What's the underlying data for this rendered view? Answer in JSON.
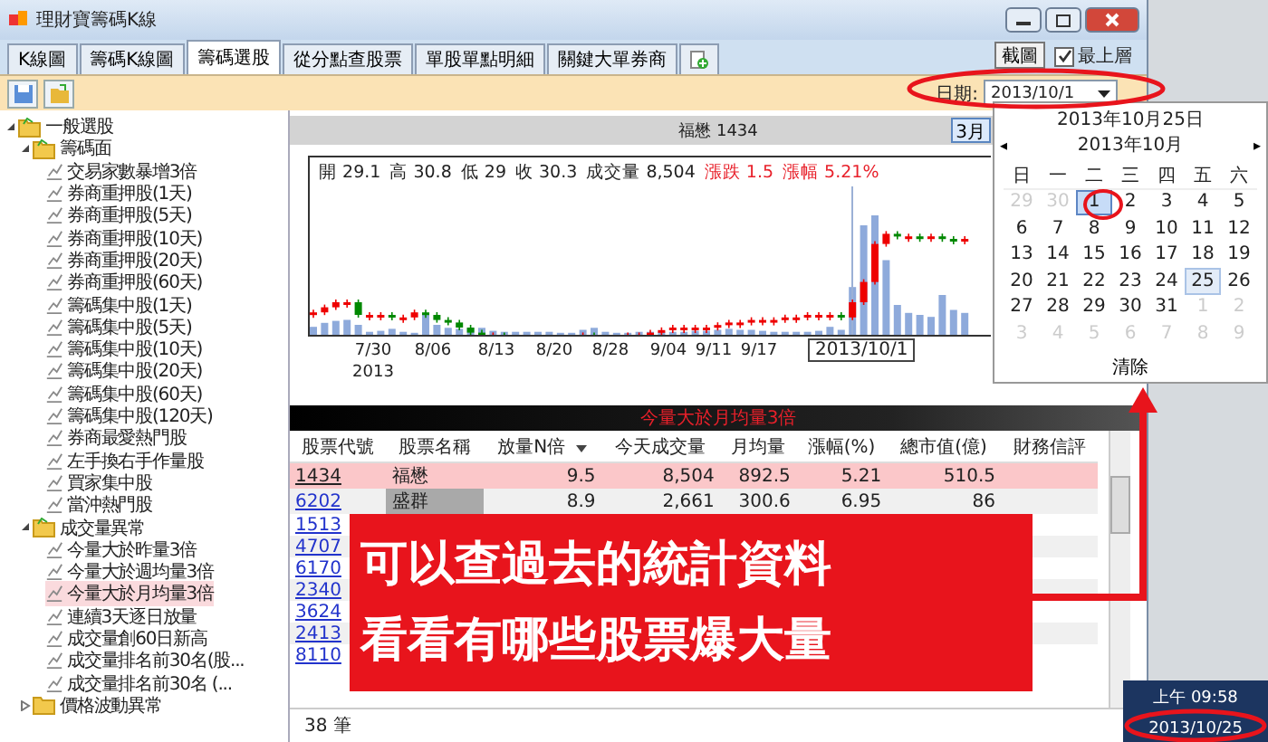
{
  "window": {
    "title": "理財寶籌碼K線"
  },
  "tabs": [
    {
      "label": "K線圖",
      "selected": false
    },
    {
      "label": "籌碼K線圖",
      "selected": false
    },
    {
      "label": "籌碼選股",
      "selected": true
    },
    {
      "label": "從分點查股票",
      "selected": false
    },
    {
      "label": "單股單點明細",
      "selected": false
    },
    {
      "label": "關鍵大單券商",
      "selected": false
    }
  ],
  "screenshot_button": "截圖",
  "topmost": {
    "label": "最上層",
    "checked": true
  },
  "date_filter": {
    "label": "日期:",
    "value": "2013/10/1"
  },
  "tree": [
    {
      "label": "一般選股",
      "kind": "folder",
      "expanded": true,
      "children": [
        {
          "label": "籌碼面",
          "kind": "folder",
          "expanded": true,
          "children": [
            {
              "label": "交易家數暴增3倍",
              "kind": "leaf",
              "selected": false
            },
            {
              "label": "券商重押股(1天)",
              "kind": "leaf",
              "selected": false
            },
            {
              "label": "券商重押股(5天)",
              "kind": "leaf",
              "selected": false
            },
            {
              "label": "券商重押股(10天)",
              "kind": "leaf",
              "selected": false
            },
            {
              "label": "券商重押股(20天)",
              "kind": "leaf",
              "selected": false
            },
            {
              "label": "券商重押股(60天)",
              "kind": "leaf",
              "selected": false
            },
            {
              "label": "籌碼集中股(1天)",
              "kind": "leaf",
              "selected": false
            },
            {
              "label": "籌碼集中股(5天)",
              "kind": "leaf",
              "selected": false
            },
            {
              "label": "籌碼集中股(10天)",
              "kind": "leaf",
              "selected": false
            },
            {
              "label": "籌碼集中股(20天)",
              "kind": "leaf",
              "selected": false
            },
            {
              "label": "籌碼集中股(60天)",
              "kind": "leaf",
              "selected": false
            },
            {
              "label": "籌碼集中股(120天)",
              "kind": "leaf",
              "selected": false
            },
            {
              "label": "券商最愛熱門股",
              "kind": "leaf",
              "selected": false
            },
            {
              "label": "左手換右手作量股",
              "kind": "leaf",
              "selected": false
            },
            {
              "label": "買家集中股",
              "kind": "leaf",
              "selected": false
            },
            {
              "label": "當沖熱門股",
              "kind": "leaf",
              "selected": false
            }
          ]
        },
        {
          "label": "成交量異常",
          "kind": "folder",
          "expanded": true,
          "children": [
            {
              "label": "今量大於昨量3倍",
              "kind": "leaf",
              "selected": false
            },
            {
              "label": "今量大於週均量3倍",
              "kind": "leaf",
              "selected": false
            },
            {
              "label": "今量大於月均量3倍",
              "kind": "leaf",
              "selected": true
            },
            {
              "label": "連續3天逐日放量",
              "kind": "leaf",
              "selected": false
            },
            {
              "label": "成交量創60日新高",
              "kind": "leaf",
              "selected": false
            },
            {
              "label": "成交量排名前30名(股...",
              "kind": "leaf",
              "selected": false
            },
            {
              "label": "成交量排名前30名 (...",
              "kind": "leaf",
              "selected": false
            }
          ]
        },
        {
          "label": "價格波動異常",
          "kind": "folder",
          "expanded": false
        }
      ]
    }
  ],
  "chart": {
    "title": "福懋 1434",
    "range_button": "3月",
    "quote": [
      {
        "text": "開 29.1",
        "color": "#222222"
      },
      {
        "text": "高 30.8",
        "color": "#222222"
      },
      {
        "text": "低 29",
        "color": "#222222"
      },
      {
        "text": "收 30.3",
        "color": "#222222"
      },
      {
        "text": "成交量 8,504",
        "color": "#222222"
      },
      {
        "text": "漲跌 1.5",
        "color": "#e8202a"
      },
      {
        "text": "漲幅 5.21%",
        "color": "#e8202a"
      }
    ],
    "x_labels": [
      "7/30",
      "8/06",
      "8/13",
      "8/20",
      "8/28",
      "9/04",
      "9/11",
      "9/17"
    ],
    "year_label": "2013",
    "cursor_label": "2013/10/1"
  },
  "table": {
    "title": "今量大於月均量3倍",
    "columns": [
      "股票代號",
      "股票名稱",
      "放量N倍",
      "今天成交量",
      "月均量",
      "漲幅(%)",
      "總市值(億)",
      "財務信評"
    ],
    "rows": [
      {
        "selected": true,
        "cells": [
          "1434",
          "福懋",
          "9.5",
          "8,504",
          "892.5",
          "5.21",
          "510.5"
        ]
      },
      {
        "selected": false,
        "cells": [
          "6202",
          "盛群",
          "8.9",
          "2,661",
          "300.6",
          "6.95",
          "86"
        ]
      },
      {
        "selected": false,
        "cells": [
          "1513"
        ]
      },
      {
        "selected": false,
        "cells": [
          "4707"
        ]
      },
      {
        "selected": false,
        "cells": [
          "6170"
        ]
      },
      {
        "selected": false,
        "cells": [
          "2340"
        ]
      },
      {
        "selected": false,
        "cells": [
          "3624"
        ]
      },
      {
        "selected": false,
        "cells": [
          "2413"
        ]
      },
      {
        "selected": false,
        "cells": [
          "8110"
        ]
      }
    ],
    "count": "38 筆"
  },
  "calendar": {
    "today_label": "2013年10月25日",
    "month": "2013年10月",
    "prev": "◂",
    "next": "▸",
    "weekdays": [
      "日",
      "一",
      "二",
      "三",
      "四",
      "五",
      "六"
    ],
    "days": [
      {
        "text": "29",
        "muted": true,
        "selected": false,
        "today": false
      },
      {
        "text": "30",
        "muted": true,
        "selected": false,
        "today": false
      },
      {
        "text": "1",
        "muted": false,
        "selected": true,
        "today": false
      },
      {
        "text": "2",
        "muted": false,
        "selected": false,
        "today": false
      },
      {
        "text": "3",
        "muted": false,
        "selected": false,
        "today": false
      },
      {
        "text": "4",
        "muted": false,
        "selected": false,
        "today": false
      },
      {
        "text": "5",
        "muted": false,
        "selected": false,
        "today": false
      },
      {
        "text": "6",
        "muted": false,
        "selected": false,
        "today": false
      },
      {
        "text": "7",
        "muted": false,
        "selected": false,
        "today": false
      },
      {
        "text": "8",
        "muted": false,
        "selected": false,
        "today": false
      },
      {
        "text": "9",
        "muted": false,
        "selected": false,
        "today": false
      },
      {
        "text": "10",
        "muted": false,
        "selected": false,
        "today": false
      },
      {
        "text": "11",
        "muted": false,
        "selected": false,
        "today": false
      },
      {
        "text": "12",
        "muted": false,
        "selected": false,
        "today": false
      },
      {
        "text": "13",
        "muted": false,
        "selected": false,
        "today": false
      },
      {
        "text": "14",
        "muted": false,
        "selected": false,
        "today": false
      },
      {
        "text": "15",
        "muted": false,
        "selected": false,
        "today": false
      },
      {
        "text": "16",
        "muted": false,
        "selected": false,
        "today": false
      },
      {
        "text": "17",
        "muted": false,
        "selected": false,
        "today": false
      },
      {
        "text": "18",
        "muted": false,
        "selected": false,
        "today": false
      },
      {
        "text": "19",
        "muted": false,
        "selected": false,
        "today": false
      },
      {
        "text": "20",
        "muted": false,
        "selected": false,
        "today": false
      },
      {
        "text": "21",
        "muted": false,
        "selected": false,
        "today": false
      },
      {
        "text": "22",
        "muted": false,
        "selected": false,
        "today": false
      },
      {
        "text": "23",
        "muted": false,
        "selected": false,
        "today": false
      },
      {
        "text": "24",
        "muted": false,
        "selected": false,
        "today": false
      },
      {
        "text": "25",
        "muted": false,
        "selected": false,
        "today": true
      },
      {
        "text": "26",
        "muted": false,
        "selected": false,
        "today": false
      },
      {
        "text": "27",
        "muted": false,
        "selected": false,
        "today": false
      },
      {
        "text": "28",
        "muted": false,
        "selected": false,
        "today": false
      },
      {
        "text": "29",
        "muted": false,
        "selected": false,
        "today": false
      },
      {
        "text": "30",
        "muted": false,
        "selected": false,
        "today": false
      },
      {
        "text": "31",
        "muted": false,
        "selected": false,
        "today": false
      },
      {
        "text": "1",
        "muted": true,
        "selected": false,
        "today": false
      },
      {
        "text": "2",
        "muted": true,
        "selected": false,
        "today": false
      },
      {
        "text": "3",
        "muted": true,
        "selected": false,
        "today": false
      },
      {
        "text": "4",
        "muted": true,
        "selected": false,
        "today": false
      },
      {
        "text": "5",
        "muted": true,
        "selected": false,
        "today": false
      },
      {
        "text": "6",
        "muted": true,
        "selected": false,
        "today": false
      },
      {
        "text": "7",
        "muted": true,
        "selected": false,
        "today": false
      },
      {
        "text": "8",
        "muted": true,
        "selected": false,
        "today": false
      },
      {
        "text": "9",
        "muted": true,
        "selected": false,
        "today": false
      }
    ],
    "clear": "清除"
  },
  "taskbar": {
    "time": "上午 09:58",
    "date": "2013/10/25"
  },
  "annotation": {
    "lines": [
      "可以查過去的統計資料",
      "看看有哪些股票爆大量"
    ]
  }
}
